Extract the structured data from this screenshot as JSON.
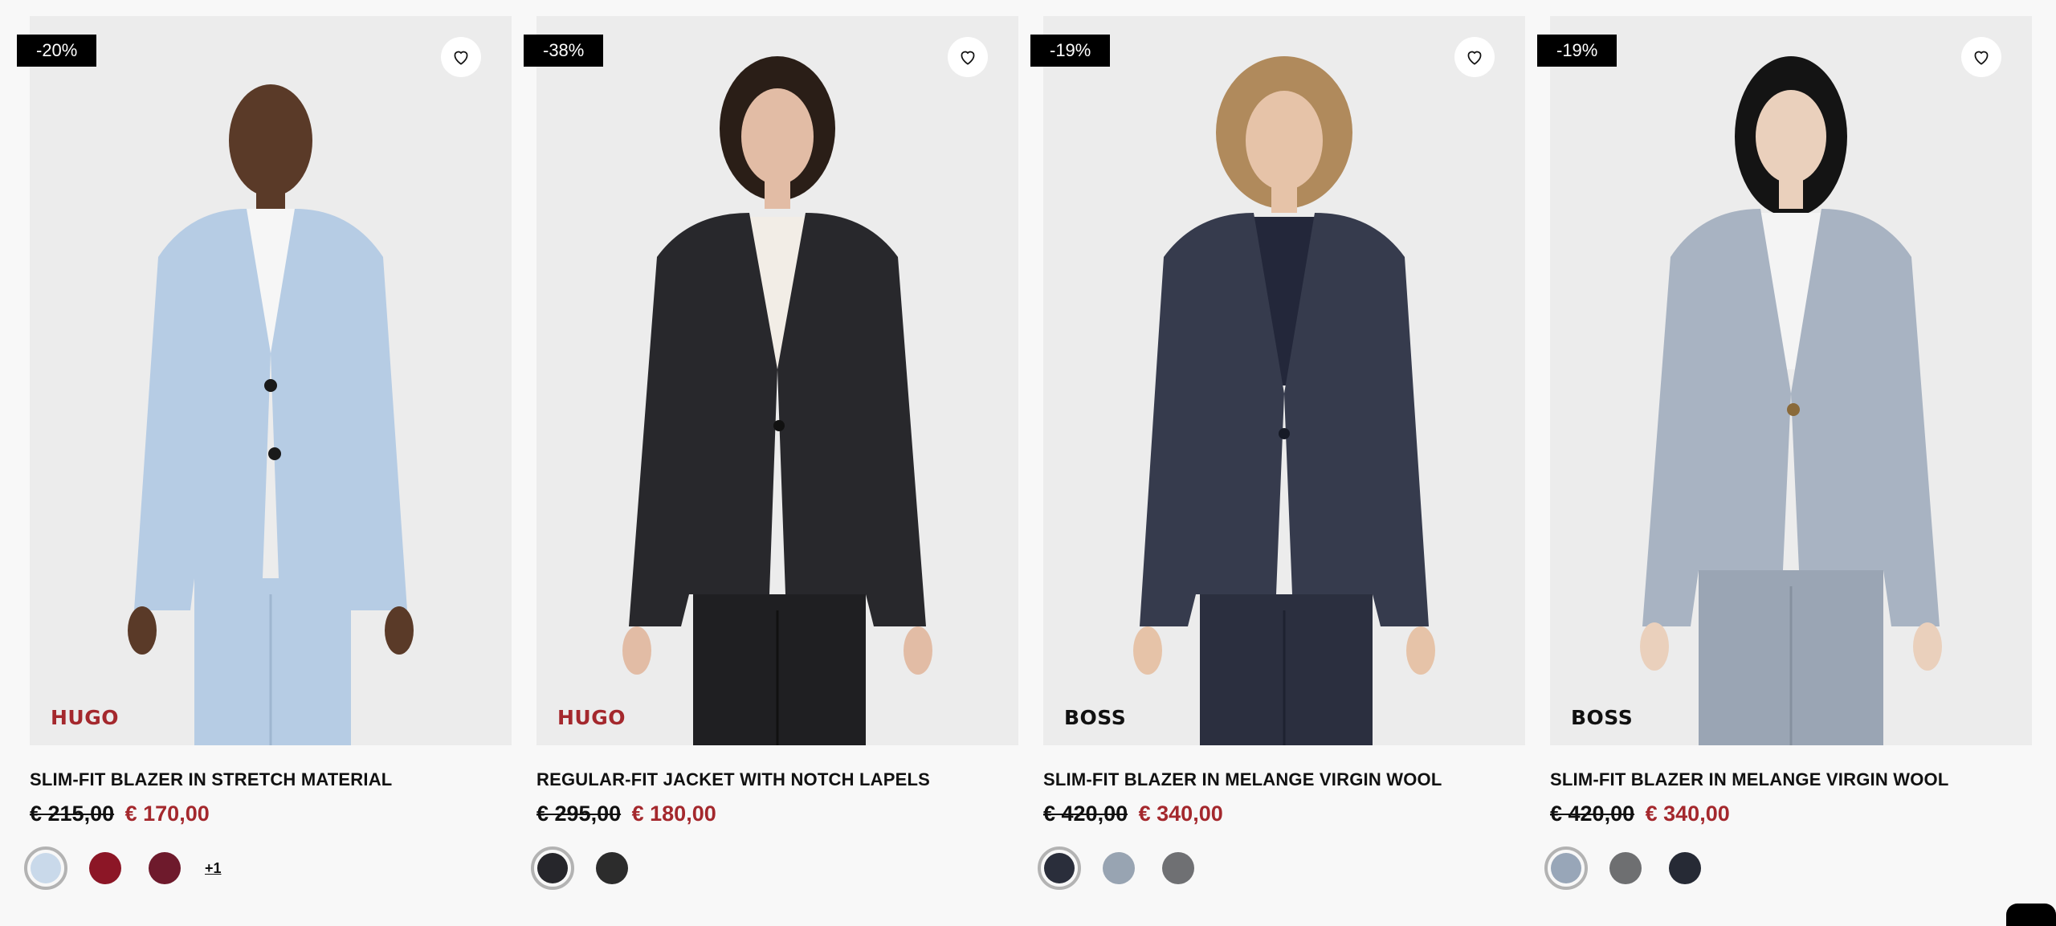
{
  "products": [
    {
      "discount": "-20%",
      "brand": "HUGO",
      "brand_color": "#a4282d",
      "title": "SLIM-FIT BLAZER IN STRETCH MATERIAL",
      "old_price": "€ 215,00",
      "new_price": "€ 170,00",
      "swatches": [
        "#c9d9ea",
        "#8c1626",
        "#6e1a2c"
      ],
      "more_colors": "+1",
      "wishlist_icon": "heart-outline-icon"
    },
    {
      "discount": "-38%",
      "brand": "HUGO",
      "brand_color": "#a4282d",
      "title": "REGULAR-FIT JACKET WITH NOTCH LAPELS",
      "old_price": "€ 295,00",
      "new_price": "€ 180,00",
      "swatches": [
        "#26262b",
        "#2c2c2c"
      ],
      "wishlist_icon": "heart-outline-icon"
    },
    {
      "discount": "-19%",
      "brand": "BOSS",
      "brand_color": "#111111",
      "title": "SLIM-FIT BLAZER IN MELANGE VIRGIN WOOL",
      "old_price": "€ 420,00",
      "new_price": "€ 340,00",
      "swatches": [
        "#2a2e3b",
        "#98a4b2",
        "#6f7073"
      ],
      "wishlist_icon": "heart-outline-icon"
    },
    {
      "discount": "-19%",
      "brand": "BOSS",
      "brand_color": "#111111",
      "title": "SLIM-FIT BLAZER IN MELANGE VIRGIN WOOL",
      "old_price": "€ 420,00",
      "new_price": "€ 340,00",
      "swatches": [
        "#98a6b8",
        "#6e6f71",
        "#262a35"
      ],
      "wishlist_icon": "heart-outline-icon"
    }
  ],
  "colors": {
    "sale_red": "#a4282d",
    "badge_bg": "#000000",
    "page_bg": "#f8f8f8"
  }
}
